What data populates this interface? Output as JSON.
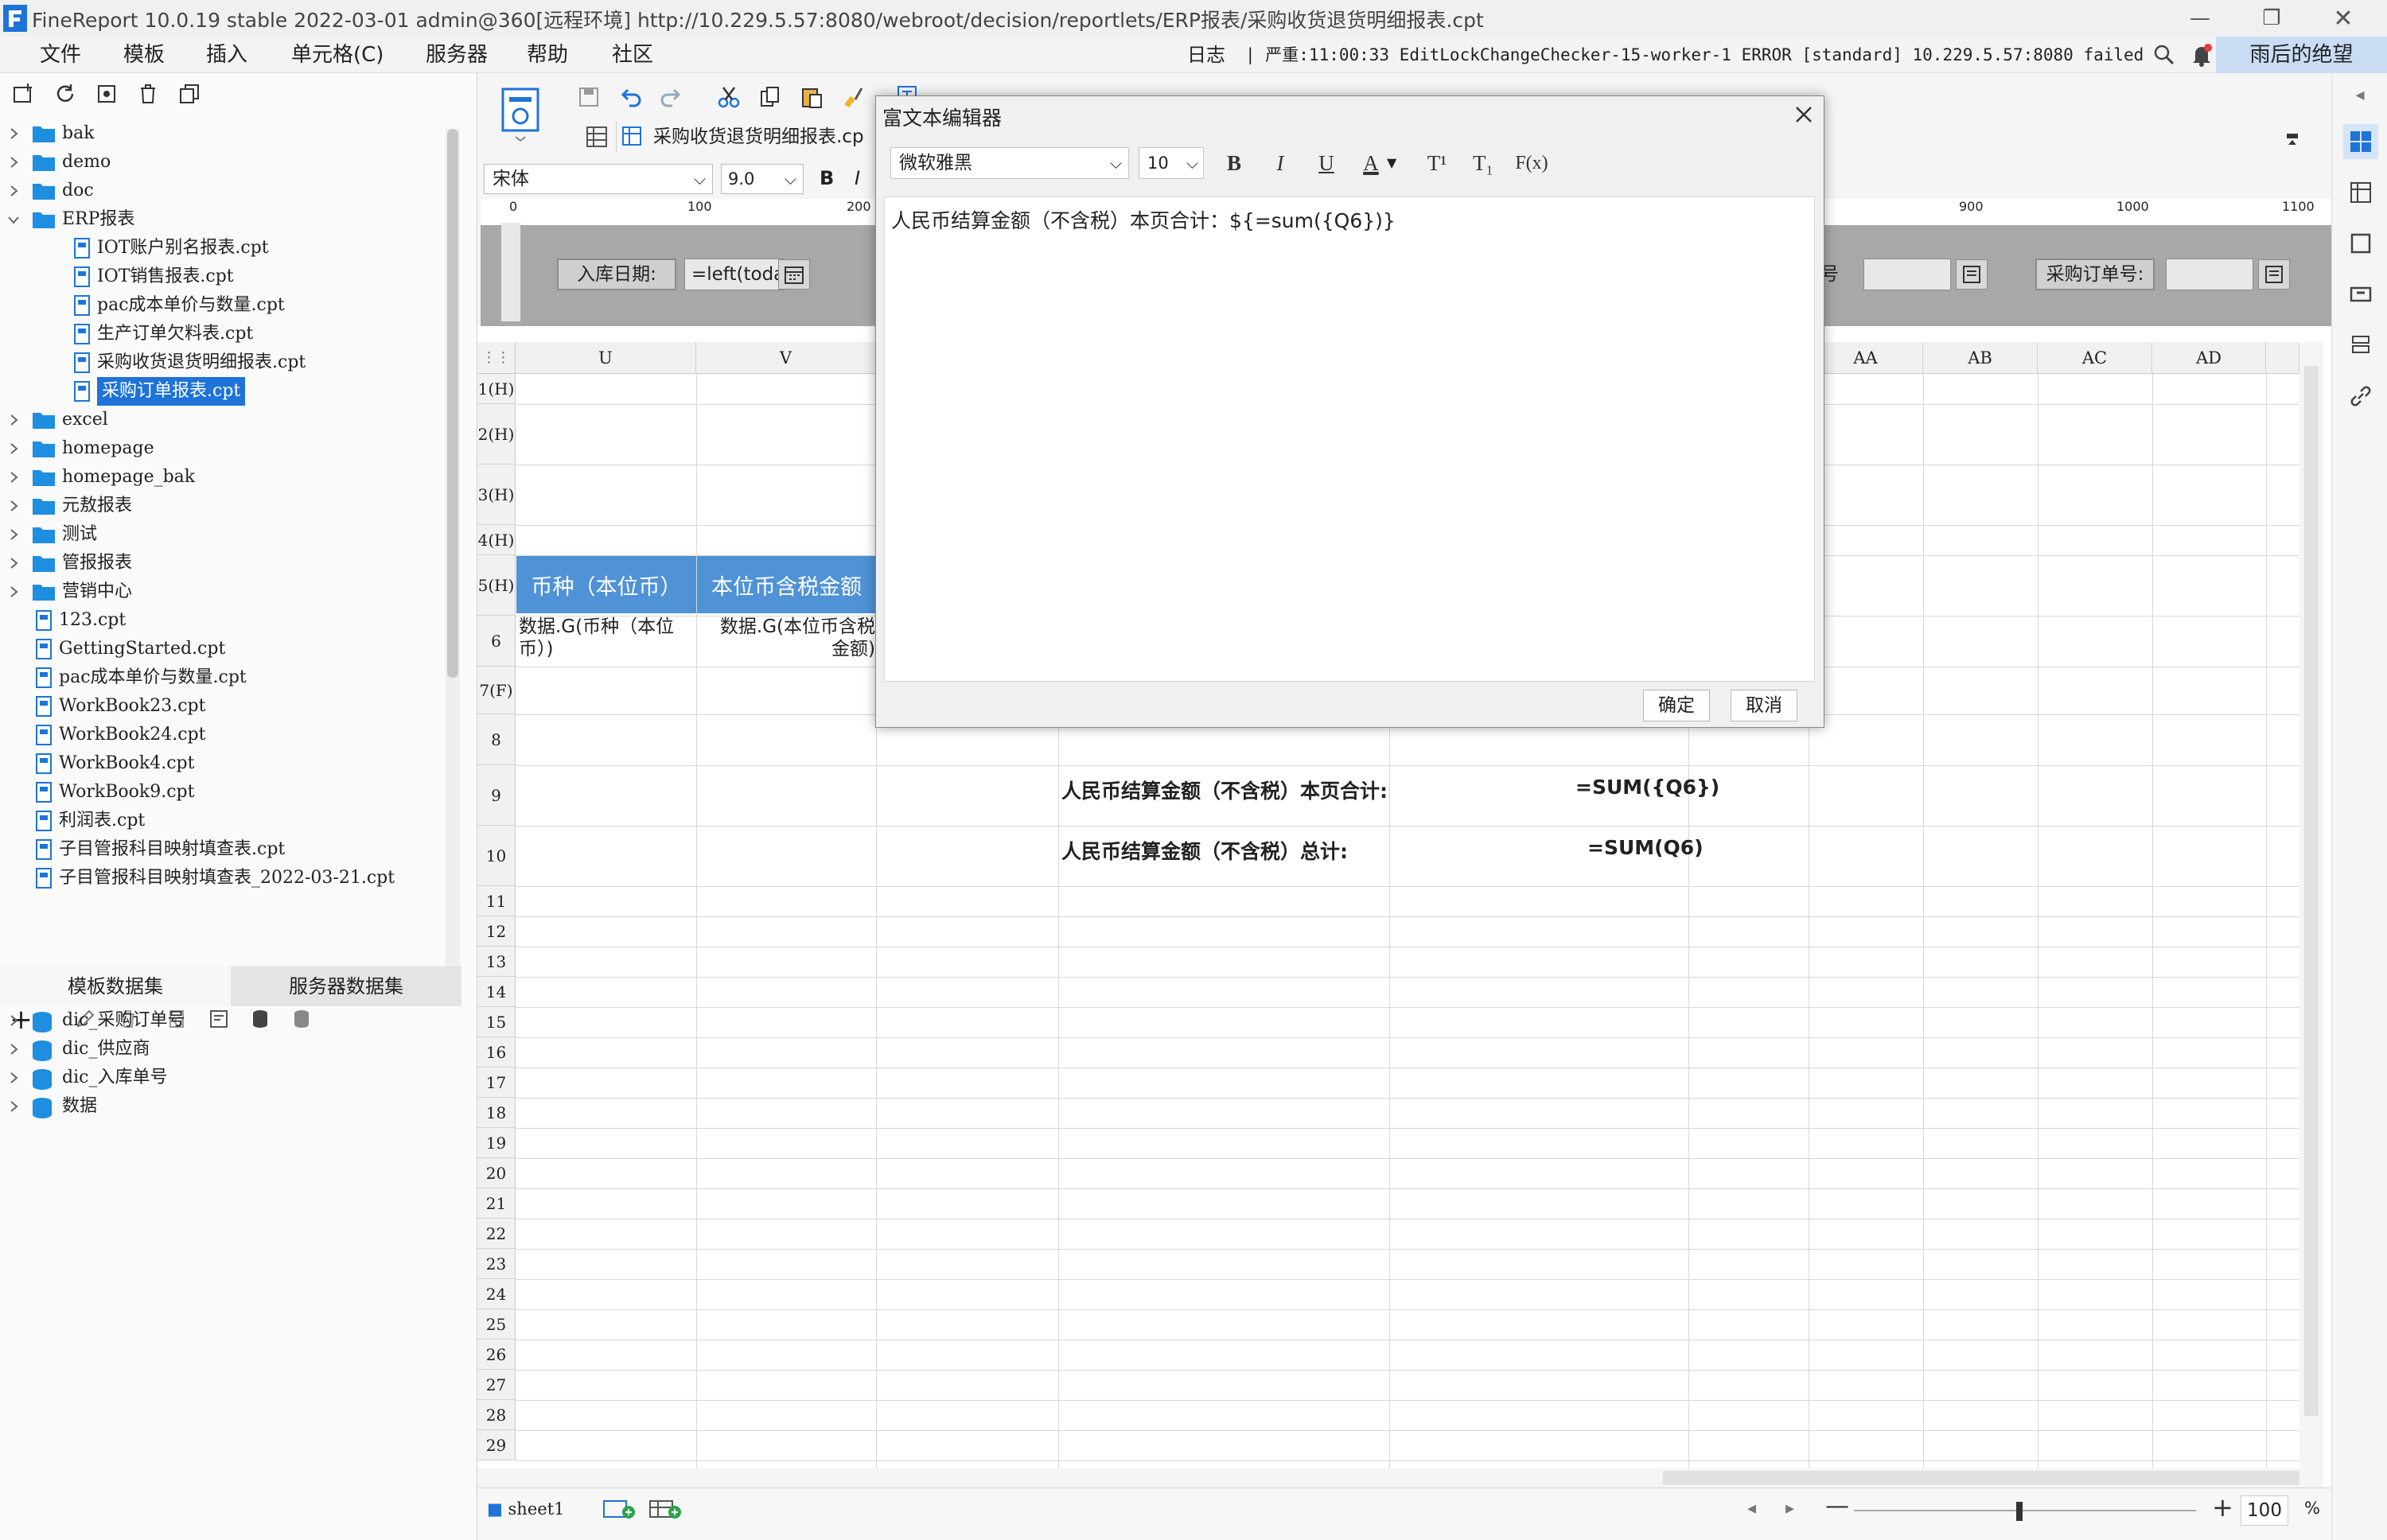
{
  "window": {
    "title": "FineReport 10.0.19 stable 2022-03-01 admin@360[远程环境]   http://10.229.5.57:8080/webroot/decision/reportlets/ERP报表/采购收货退货明细报表.cpt"
  },
  "menu": {
    "items": [
      "文件",
      "模板",
      "插入",
      "单元格(C)",
      "服务器",
      "帮助",
      "社区"
    ],
    "log_label": "日志",
    "log_message": "| 严重:11:00:33 EditLockChangeChecker-15-worker-1 ERROR [standard] 10.229.5.57:8080 failed t...",
    "user": "雨后的绝望"
  },
  "file_tree": [
    {
      "label": "bak",
      "type": "folder",
      "depth": 0,
      "expanded": false
    },
    {
      "label": "demo",
      "type": "folder",
      "depth": 0,
      "expanded": false
    },
    {
      "label": "doc",
      "type": "folder",
      "depth": 0,
      "expanded": false
    },
    {
      "label": "ERP报表",
      "type": "folder",
      "depth": 0,
      "expanded": true
    },
    {
      "label": "IOT账户别名报表.cpt",
      "type": "file",
      "depth": 1
    },
    {
      "label": "IOT销售报表.cpt",
      "type": "file",
      "depth": 1
    },
    {
      "label": "pac成本单价与数量.cpt",
      "type": "file",
      "depth": 1
    },
    {
      "label": "生产订单欠料表.cpt",
      "type": "file",
      "depth": 1
    },
    {
      "label": "采购收货退货明细报表.cpt",
      "type": "file",
      "depth": 1
    },
    {
      "label": "采购订单报表.cpt",
      "type": "file",
      "depth": 1,
      "selected": true
    },
    {
      "label": "excel",
      "type": "folder",
      "depth": 0,
      "expanded": false
    },
    {
      "label": "homepage",
      "type": "folder",
      "depth": 0,
      "expanded": false
    },
    {
      "label": "homepage_bak",
      "type": "folder",
      "depth": 0,
      "expanded": false
    },
    {
      "label": "元敖报表",
      "type": "folder",
      "depth": 0,
      "expanded": false
    },
    {
      "label": "测试",
      "type": "folder",
      "depth": 0,
      "expanded": false
    },
    {
      "label": "管报报表",
      "type": "folder",
      "depth": 0,
      "expanded": false
    },
    {
      "label": "营销中心",
      "type": "folder",
      "depth": 0,
      "expanded": false
    },
    {
      "label": "123.cpt",
      "type": "file",
      "depth": 0
    },
    {
      "label": "GettingStarted.cpt",
      "type": "file",
      "depth": 0
    },
    {
      "label": "pac成本单价与数量.cpt",
      "type": "file",
      "depth": 0
    },
    {
      "label": "WorkBook23.cpt",
      "type": "file",
      "depth": 0
    },
    {
      "label": "WorkBook24.cpt",
      "type": "file",
      "depth": 0
    },
    {
      "label": "WorkBook4.cpt",
      "type": "file",
      "depth": 0
    },
    {
      "label": "WorkBook9.cpt",
      "type": "file",
      "depth": 0
    },
    {
      "label": "利润表.cpt",
      "type": "file",
      "depth": 0
    },
    {
      "label": "子目管报科目映射填查表.cpt",
      "type": "file",
      "depth": 0
    },
    {
      "label": "子目管报科目映射填查表_2022-03-21.cpt",
      "type": "file",
      "depth": 0
    }
  ],
  "dataset_tabs": [
    "模板数据集",
    "服务器数据集"
  ],
  "datasets": [
    "dic_采购订单号",
    "dic_供应商",
    "dic_入库单号",
    "数据"
  ],
  "editor": {
    "template_tab": "采购收货退货明细报表.cp",
    "font": "宋体",
    "font_size": "9.0",
    "ruler_ticks": [
      "0",
      "100",
      "200",
      "900",
      "1000",
      "1100"
    ],
    "params": [
      {
        "label": "入库日期:",
        "value": "=left(toda"
      },
      {
        "label": "号",
        "value": ""
      },
      {
        "label": "采购订单号:",
        "value": ""
      }
    ]
  },
  "grid": {
    "columns": [
      "U",
      "V",
      "AA",
      "AB",
      "AC",
      "AD"
    ],
    "rows": [
      "1(H)",
      "2(H)",
      "3(H)",
      "4(H)",
      "5(H)",
      "6",
      "7(F)",
      "8",
      "9",
      "10",
      "11",
      "12",
      "13",
      "14",
      "15",
      "16",
      "17",
      "18",
      "19",
      "20",
      "21",
      "22",
      "23",
      "24",
      "25",
      "26",
      "27",
      "28",
      "29"
    ],
    "header_cells": [
      "币种（本位币）",
      "本位币含税金额"
    ],
    "data_cells": [
      "数据.G(币种（本位币）)",
      "数据.G(本位币含税金额)"
    ],
    "summary": [
      {
        "label": "人民币结算金额（不含税）本页合计:",
        "formula": "=SUM({Q6})"
      },
      {
        "label": "人民币结算金额（不含税）总计:",
        "formula": "=SUM(Q6)"
      }
    ]
  },
  "dialog": {
    "title": "富文本编辑器",
    "font": "微软雅黑",
    "font_size": "10",
    "format_buttons": [
      "B",
      "I",
      "U",
      "A",
      "T¹",
      "T₁",
      "F(x)"
    ],
    "content": "人民币结算金额（不含税）本页合计：${=sum({Q6})}",
    "ok_label": "确定",
    "cancel_label": "取消"
  },
  "bottom": {
    "sheet_tab": "sheet1",
    "zoom": "100",
    "zoom_unit": "%"
  },
  "colors": {
    "accent_blue": "#1e73d8",
    "header_cell_blue": "#4f92d6",
    "param_area": "#a8a8a8"
  }
}
